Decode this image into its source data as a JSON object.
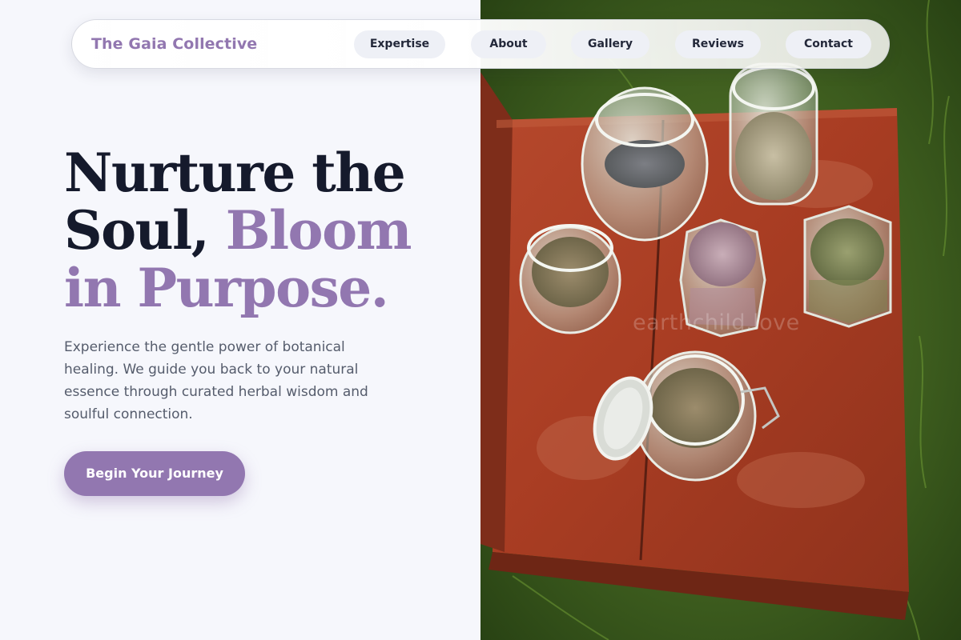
{
  "brand": {
    "name": "The Gaia Collective"
  },
  "nav": {
    "links": [
      {
        "label": "Expertise"
      },
      {
        "label": "About"
      },
      {
        "label": "Gallery"
      },
      {
        "label": "Reviews"
      },
      {
        "label": "Contact"
      }
    ]
  },
  "hero": {
    "headline_part1": "Nurture the Soul, ",
    "headline_accent": "Bloom in Purpose.",
    "description": "Experience the gentle power of botanical healing. We guide you back to your natural essence through curated herbal wisdom and soulful connection.",
    "cta_label": "Begin Your Journey",
    "image_watermark": "earthchild.love"
  },
  "colors": {
    "accent": "#9277b0",
    "heading": "#151a2c",
    "body_text": "#555c6c",
    "page_background": "#f6f7fc"
  }
}
